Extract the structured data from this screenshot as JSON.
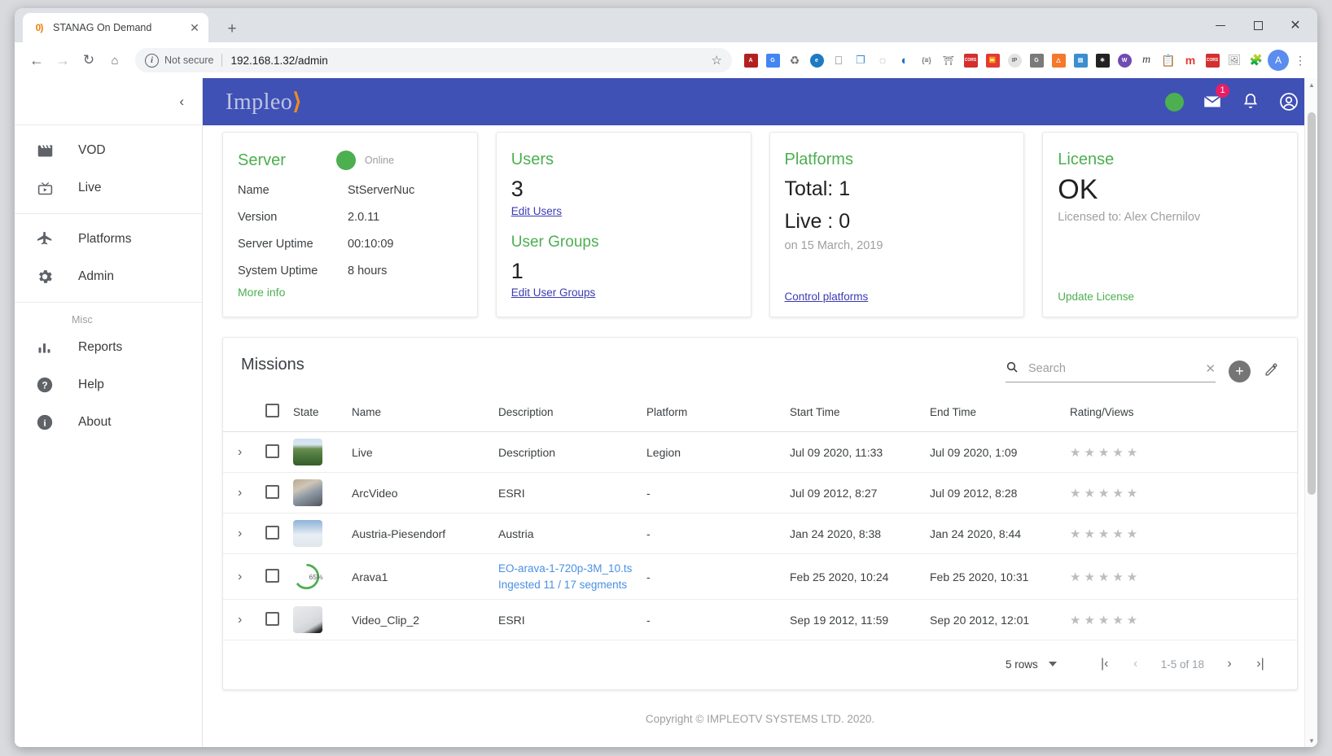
{
  "browser": {
    "tab": {
      "title": "STANAG On Demand",
      "favicon": "impleo-logo-icon",
      "close": "✕"
    },
    "newtab_label": "+",
    "window_controls": {
      "minimize": "minimize-icon",
      "maximize": "maximize-icon",
      "close": "✕"
    },
    "nav": {
      "back": "←",
      "forward": "→",
      "reload": "⟳",
      "home": "⌂"
    },
    "omnibox": {
      "security_label": "Not secure",
      "url": "192.168.1.32/admin",
      "star": "☆"
    },
    "extensions": [
      {
        "name": "dictionary-extension-icon",
        "glyph": "📕",
        "color": "#b32020"
      },
      {
        "name": "google-translate-icon",
        "glyph": "G",
        "color": "#4285f4"
      },
      {
        "name": "recycle-extension-icon",
        "glyph": "♻",
        "color": "#6b6b6b"
      },
      {
        "name": "edge-style-extension-icon",
        "glyph": "e",
        "color": "#1f7ac2"
      },
      {
        "name": "window-resizer-icon",
        "glyph": "▭",
        "color": "#5f6368"
      },
      {
        "name": "window-split-icon",
        "glyph": "❐",
        "color": "#3b8ed0"
      },
      {
        "name": "circle-dots-extension-icon",
        "glyph": "◌",
        "color": "#8a8a8a"
      },
      {
        "name": "opera-style-extension-icon",
        "glyph": "◐",
        "color": "#1d74c4"
      },
      {
        "name": "json-viewer-icon",
        "glyph": "{≡}",
        "color": "#3c4043"
      },
      {
        "name": "university-extension-icon",
        "glyph": "🏛",
        "color": "#6b6b6b"
      },
      {
        "name": "cors-extension-icon",
        "glyph": "CORS",
        "color": "#d32f2f"
      },
      {
        "name": "fast-forward-extension-icon",
        "glyph": "▶▶",
        "color": "#e53935"
      },
      {
        "name": "ip-lookup-icon",
        "glyph": "IP",
        "color": "#6b6b6b"
      },
      {
        "name": "grammarly-icon",
        "glyph": "G",
        "color": "#6b6b6b"
      },
      {
        "name": "analytics-extension-icon",
        "glyph": "📈",
        "color": "#f4792b"
      },
      {
        "name": "bookmark-extension-icon",
        "glyph": "◧",
        "color": "#3b8ed0"
      },
      {
        "name": "react-devtools-icon",
        "glyph": "⚛",
        "color": "#222222"
      },
      {
        "name": "wappalyzer-icon",
        "glyph": "W",
        "color": "#6f4bb2"
      },
      {
        "name": "m-extension-icon",
        "glyph": "m",
        "color": "#3c4043"
      },
      {
        "name": "form-filler-icon",
        "glyph": "🗒",
        "color": "#3b8ed0"
      },
      {
        "name": "mailtrack-icon",
        "glyph": "m",
        "color": "#e53935"
      },
      {
        "name": "cors-toggle-icon",
        "glyph": "CORS",
        "color": "#d32f2f"
      },
      {
        "name": "screenshot-extension-icon",
        "glyph": "🖨",
        "color": "#8a8a8a"
      },
      {
        "name": "puzzle-extensions-icon",
        "glyph": "🧩",
        "color": "#5f6368"
      }
    ],
    "profile_initial": "A"
  },
  "sidebar": {
    "collapse_icon": "‹",
    "groups": [
      {
        "items": [
          {
            "label": "VOD",
            "icon": "clapperboard-icon"
          },
          {
            "label": "Live",
            "icon": "tv-icon"
          }
        ]
      },
      {
        "items": [
          {
            "label": "Platforms",
            "icon": "airplane-icon"
          },
          {
            "label": "Admin",
            "icon": "gear-icon"
          }
        ]
      }
    ],
    "misc_label": "Misc",
    "misc_items": [
      {
        "label": "Reports",
        "icon": "bar-chart-icon"
      },
      {
        "label": "Help",
        "icon": "question-circle-icon"
      },
      {
        "label": "About",
        "icon": "info-circle-icon"
      }
    ]
  },
  "appbar": {
    "logo_text": "Impleo",
    "logo_mark": "⟩",
    "status_dot_color": "#4caf50",
    "mail_badge": "1",
    "icons": {
      "mail": "mail-icon",
      "bell": "bell-icon",
      "account": "account-circle-icon"
    }
  },
  "cards": {
    "server": {
      "title": "Server",
      "status_text": "Online",
      "rows": [
        {
          "key": "Name",
          "value": "StServerNuc"
        },
        {
          "key": "Version",
          "value": "2.0.11"
        },
        {
          "key": "Server Uptime",
          "value": "00:10:09"
        },
        {
          "key": "System Uptime",
          "value": "8 hours"
        }
      ],
      "more_info": "More info"
    },
    "users": {
      "title": "Users",
      "count": "3",
      "edit_link": "Edit Users",
      "groups_title": "User Groups",
      "groups_count": "1",
      "groups_edit_link": "Edit User Groups"
    },
    "platforms": {
      "title": "Platforms",
      "total": "Total: 1",
      "live": "Live : 0",
      "date": "on 15 March, 2019",
      "control_link": "Control platforms"
    },
    "license": {
      "title": "License",
      "status": "OK",
      "licensed_to": "Licensed to: Alex Chernilov",
      "update_link": "Update License"
    }
  },
  "missions": {
    "title": "Missions",
    "search": {
      "placeholder": "Search",
      "value": "",
      "clear_icon": "✕",
      "icon": "search-icon"
    },
    "add_button": "+",
    "edit_button": "✎",
    "columns": [
      "State",
      "Name",
      "Description",
      "Platform",
      "Start Time",
      "End Time",
      "Rating/Views"
    ],
    "rows": [
      {
        "name": "Live",
        "description": "Description",
        "platform": "Legion",
        "start": "Jul 09 2020, 11:33",
        "end": "Jul 09 2020, 1:09",
        "stars": 5,
        "thumb_class": "th-live",
        "state_type": "thumbnail"
      },
      {
        "name": "ArcVideo",
        "description": "ESRI",
        "platform": "-",
        "start": "Jul 09 2012, 8:27",
        "end": "Jul 09 2012, 8:28",
        "stars": 5,
        "thumb_class": "th-arc",
        "state_type": "thumbnail"
      },
      {
        "name": "Austria-Piesendorf",
        "description": "Austria",
        "platform": "-",
        "start": "Jan 24 2020, 8:38",
        "end": "Jan 24 2020, 8:44",
        "stars": 5,
        "thumb_class": "th-austria",
        "state_type": "thumbnail"
      },
      {
        "name": "Arava1",
        "description": "",
        "ingest_file": "EO-arava-1-720p-3M_10.ts",
        "ingest_status": "Ingested 11 / 17 segments",
        "platform": "-",
        "start": "Feb 25 2020, 10:24",
        "end": "Feb 25 2020, 10:31",
        "stars": 5,
        "state_type": "progress",
        "progress": 65,
        "progress_label": "65%"
      },
      {
        "name": "Video_Clip_2",
        "description": "ESRI",
        "platform": "-",
        "start": "Sep 19 2012, 11:59",
        "end": "Sep 20 2012, 12:01",
        "stars": 5,
        "thumb_class": "th-clip",
        "state_type": "thumbnail"
      }
    ],
    "paginator": {
      "rows_per_page": "5 rows",
      "first": "|‹",
      "prev": "‹",
      "range": "1-5 of 18",
      "next": "›",
      "last": "›|"
    }
  },
  "footer": {
    "copyright": "Copyright © IMPLEOTV SYSTEMS LTD. 2020."
  }
}
